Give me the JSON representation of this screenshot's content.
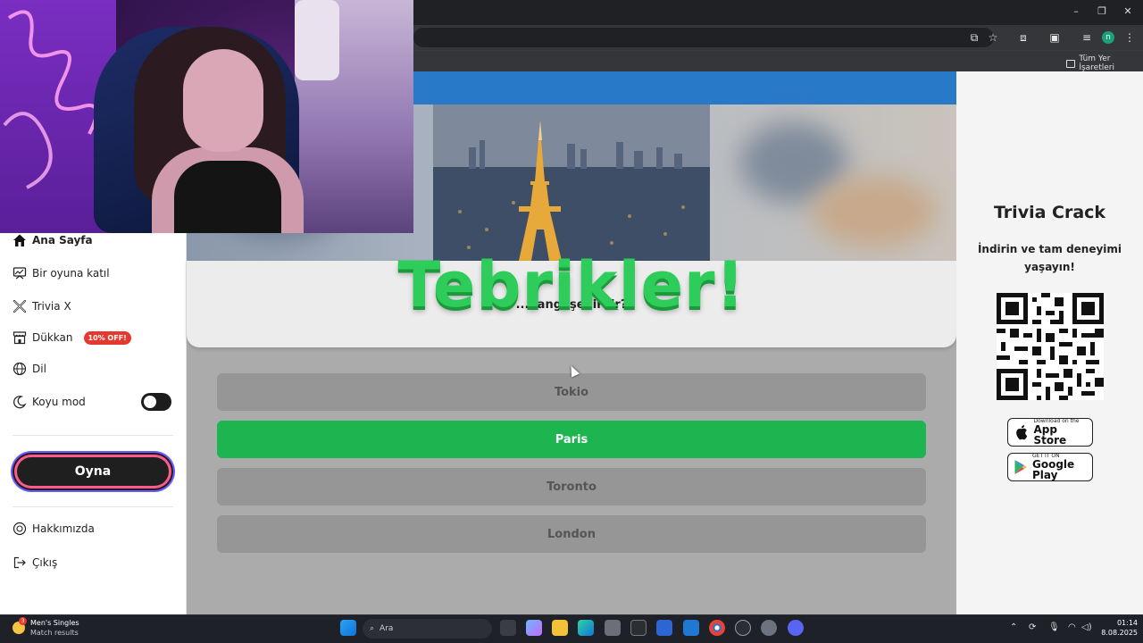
{
  "browser": {
    "bookmarks_folder": "Tüm Yer İşaretleri",
    "profile_initial": "n"
  },
  "sidebar": {
    "items": [
      {
        "label": "Ana Sayfa",
        "icon": "home-icon"
      },
      {
        "label": "Bir oyuna katıl",
        "icon": "join-game-icon"
      },
      {
        "label": "Trivia X",
        "icon": "trivia-x-icon"
      },
      {
        "label": "Dükkan",
        "icon": "shop-icon",
        "badge": "10% OFF!"
      },
      {
        "label": "Dil",
        "icon": "globe-icon"
      },
      {
        "label": "Koyu mod",
        "icon": "moon-icon",
        "toggle_on": false
      }
    ],
    "play_label": "Oyna",
    "footer_items": [
      {
        "label": "Hakkımızda",
        "icon": "about-icon"
      },
      {
        "label": "Çıkış",
        "icon": "logout-icon"
      }
    ]
  },
  "game": {
    "question_partial": "...hangi şehirdir?",
    "overlay_title": "Tebrikler!",
    "answers": [
      {
        "label": "Tokio",
        "correct": false
      },
      {
        "label": "Paris",
        "correct": true
      },
      {
        "label": "Toronto",
        "correct": false
      },
      {
        "label": "London",
        "correct": false
      }
    ],
    "colors": {
      "correct": "#1db550",
      "neutral": "#969696",
      "header": "#2979c9"
    }
  },
  "promo": {
    "brand": "Trivia Crack",
    "text": "İndirin ve tam deneyimi yaşayın!",
    "app_store": {
      "small": "Download on the",
      "big": "App Store"
    },
    "google_play": {
      "small": "GET IT ON",
      "big": "Google Play"
    }
  },
  "taskbar": {
    "news_title": "Men's Singles",
    "news_sub": "Match results",
    "news_badge": "3",
    "search_placeholder": "Ara",
    "time": "01:14",
    "date": "8.08.2025"
  }
}
